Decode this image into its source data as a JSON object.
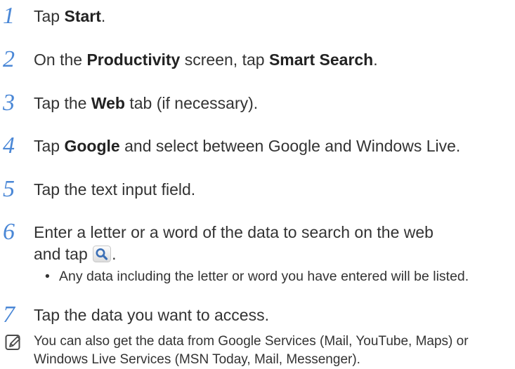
{
  "steps": [
    {
      "num": "1",
      "before": "Tap ",
      "bold": "Start",
      "after": "."
    },
    {
      "num": "2",
      "before": "On the ",
      "bold": "Productivity",
      "middle": " screen, tap ",
      "bold2": "Smart Search",
      "after": "."
    },
    {
      "num": "3",
      "before": "Tap the ",
      "bold": "Web",
      "after": " tab (if necessary)."
    },
    {
      "num": "4",
      "before": "Tap ",
      "bold": "Google",
      "after": " and select between Google and Windows Live."
    },
    {
      "num": "5",
      "text": "Tap the text input field."
    },
    {
      "num": "6",
      "line1": "Enter a letter or a word of the data to search on the web",
      "line2_before": "and tap ",
      "icon": "search-icon",
      "line2_after": "."
    },
    {
      "num": "7",
      "text": "Tap the data you want to access."
    }
  ],
  "bullet": {
    "dot": "•",
    "text": "Any data including the letter or word you have entered will be listed."
  },
  "note": {
    "icon": "note-pencil-icon",
    "text": "You can also get the data from Google Services (Mail, YouTube, Maps) or Windows Live Services (MSN Today, Mail, Messenger)."
  },
  "colors": {
    "step_number": "#4a87d6",
    "text": "#333333",
    "icon_blue": "#3b6fb6"
  }
}
